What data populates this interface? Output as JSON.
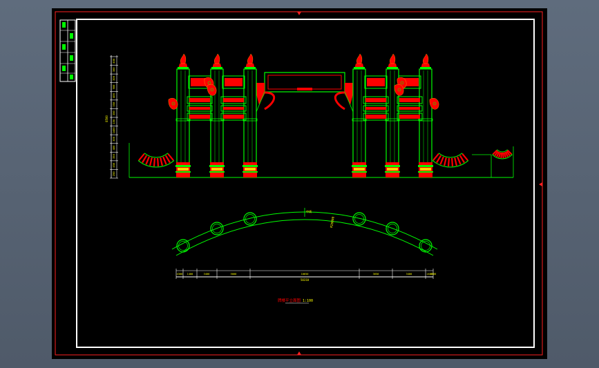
{
  "drawing": {
    "colors": {
      "background": "#000000",
      "frame": "#ff2020",
      "inner_border": "#ffffff",
      "line": "#00ff00",
      "ornament": "#ff0000",
      "dimension": "#ffff00"
    },
    "left_dimension_labels": [
      "400",
      "300",
      "300",
      "900",
      "400",
      "350",
      "350",
      "150",
      "1400",
      "300",
      "400",
      "350",
      "450",
      "250"
    ],
    "left_dimension_total": "8500",
    "plan_dimensions": [
      "4300",
      "1400",
      "3400",
      "5000",
      "10650",
      "3650",
      "3400",
      "1400",
      "4300"
    ],
    "plan_total": "50310",
    "plan_label": "R28000",
    "plan_centre_label": "中线",
    "title": "牌楼平立面图",
    "scale": "1:100"
  }
}
